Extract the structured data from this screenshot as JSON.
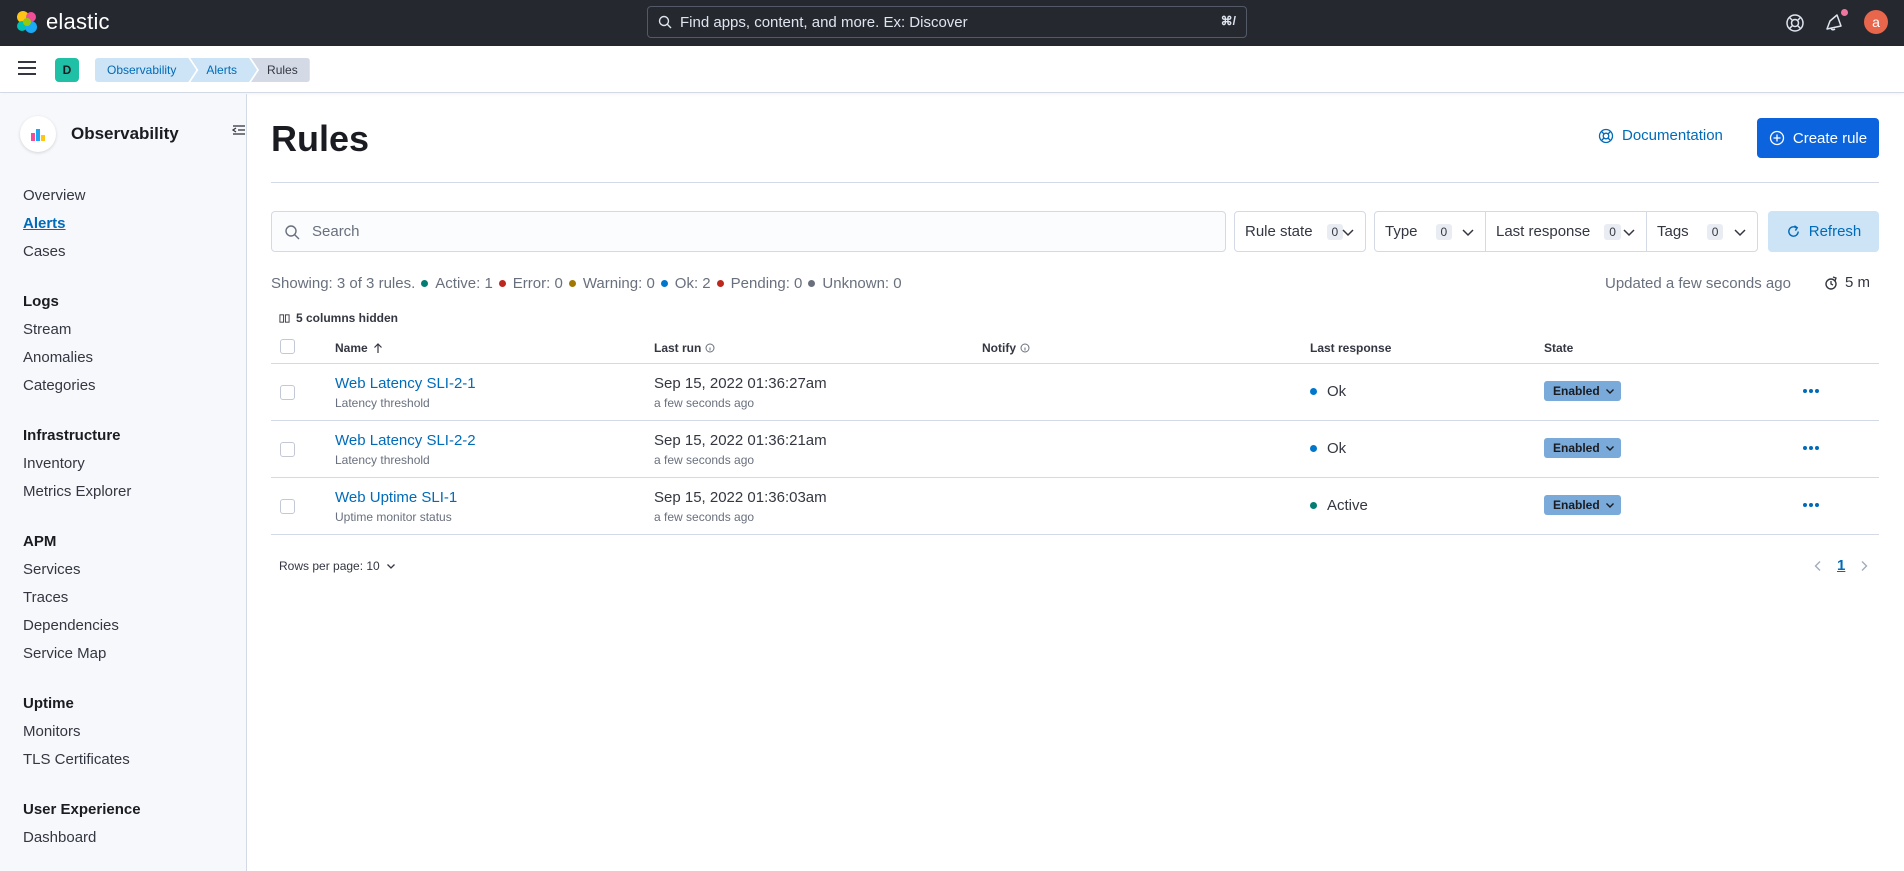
{
  "header": {
    "brand": "elastic",
    "search_placeholder": "Find apps, content, and more. Ex: Discover",
    "search_shortcut": "⌘/",
    "avatar_initial": "a"
  },
  "subbar": {
    "space_initial": "D",
    "breadcrumbs": [
      "Observability",
      "Alerts",
      "Rules"
    ]
  },
  "sidebar": {
    "title": "Observability",
    "top_items": [
      "Overview",
      "Alerts",
      "Cases"
    ],
    "active_item": "Alerts",
    "groups": [
      {
        "title": "Logs",
        "items": [
          "Stream",
          "Anomalies",
          "Categories"
        ]
      },
      {
        "title": "Infrastructure",
        "items": [
          "Inventory",
          "Metrics Explorer"
        ]
      },
      {
        "title": "APM",
        "items": [
          "Services",
          "Traces",
          "Dependencies",
          "Service Map"
        ]
      },
      {
        "title": "Uptime",
        "items": [
          "Monitors",
          "TLS Certificates"
        ]
      },
      {
        "title": "User Experience",
        "items": [
          "Dashboard"
        ]
      }
    ]
  },
  "page": {
    "title": "Rules",
    "documentation_label": "Documentation",
    "create_label": "Create rule"
  },
  "filters": {
    "search_placeholder": "Search",
    "rule_state": {
      "label": "Rule state",
      "count": "0"
    },
    "type": {
      "label": "Type",
      "count": "0"
    },
    "last_response": {
      "label": "Last response",
      "count": "0"
    },
    "tags": {
      "label": "Tags",
      "count": "0"
    },
    "refresh_label": "Refresh"
  },
  "summary": {
    "showing": "Showing: 3 of 3 rules.",
    "active": "Active: 1",
    "error": "Error: 0",
    "warning": "Warning: 0",
    "ok": "Ok: 2",
    "pending": "Pending: 0",
    "unknown": "Unknown: 0",
    "updated": "Updated a few seconds ago",
    "interval": "5 m"
  },
  "colors": {
    "active": "#017d73",
    "error": "#bd271e",
    "warning": "#c4a000",
    "ok": "#0077cc",
    "pending": "#bd271e",
    "unknown": "#69707d"
  },
  "table": {
    "columns_hidden": "5 columns hidden",
    "headers": {
      "name": "Name",
      "last_run": "Last run",
      "notify": "Notify",
      "last_response": "Last response",
      "state": "State"
    },
    "rows": [
      {
        "name": "Web Latency SLI-2-1",
        "type": "Latency threshold",
        "last_run": "Sep 15, 2022 01:36:27am",
        "ago": "a few seconds ago",
        "response": "Ok",
        "state": "Enabled"
      },
      {
        "name": "Web Latency SLI-2-2",
        "type": "Latency threshold",
        "last_run": "Sep 15, 2022 01:36:21am",
        "ago": "a few seconds ago",
        "response": "Ok",
        "state": "Enabled"
      },
      {
        "name": "Web Uptime SLI-1",
        "type": "Uptime monitor status",
        "last_run": "Sep 15, 2022 01:36:03am",
        "ago": "a few seconds ago",
        "response": "Active",
        "state": "Enabled"
      }
    ]
  },
  "pagination": {
    "rows_per_page": "Rows per page: 10",
    "current_page": "1"
  }
}
